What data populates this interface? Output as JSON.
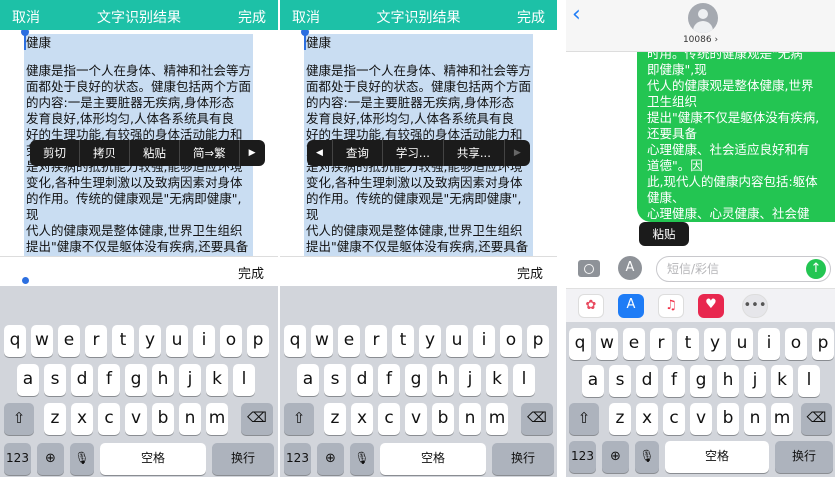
{
  "ocr": {
    "cancel": "取消",
    "title": "文字识别结果",
    "done": "完成",
    "body_title": "健康",
    "body_text": "健康是指一个人在身体、精神和社会等方\n面都处于良好的状态。健康包括两个方面\n的内容:一是主要脏器无疾病,身体形态\n发育良好,体形均匀,人体各系统具有良\n好的生理功能,有较强的身体活动能力和\n劳动能力,这是对健康最基本的要求;二\n是对疾病的抵抗能力较强,能够适应环境\n变化,各种生理刺激以及致病因素对身体\n的作用。传统的健康观是\"无病即健康\",现\n代人的健康观是整体健康,世界卫生组织\n提出\"健康不仅是躯体没有疾病,还要具备\n心理健康、社会适应良好和有道德\"。因\n此,现代人的健康内容包括:躯体健康、\n心理健康、心灵健康、社会健康、智力健",
    "keyboard_done": "完成",
    "menu1": [
      "剪切",
      "拷贝",
      "粘贴",
      "简⇒繁"
    ],
    "menu2": [
      "查询",
      "学习...",
      "共享..."
    ]
  },
  "keyboard": {
    "row1": [
      "q",
      "w",
      "e",
      "r",
      "t",
      "y",
      "u",
      "i",
      "o",
      "p"
    ],
    "row2": [
      "a",
      "s",
      "d",
      "f",
      "g",
      "h",
      "j",
      "k",
      "l"
    ],
    "row3": [
      "z",
      "x",
      "c",
      "v",
      "b",
      "n",
      "m"
    ],
    "num": "123",
    "space": "空格",
    "return": "换行"
  },
  "messages": {
    "contact": "10086 ›",
    "bubble_text": "时用。传统的健康观是\"无病\n即健康\",现\n代人的健康观是整体健康,世界\n卫生组织\n提出\"健康不仅是躯体没有疾病,\n还要具备\n心理健康、社会适应良好和有\n道德\"。因\n此,现代人的健康内容包括:躯体\n健康、\n心理健康、心灵健康、社会健\n康、智力健",
    "paste": "粘贴",
    "placeholder": "短信/彩信",
    "accent": "#23c552"
  }
}
